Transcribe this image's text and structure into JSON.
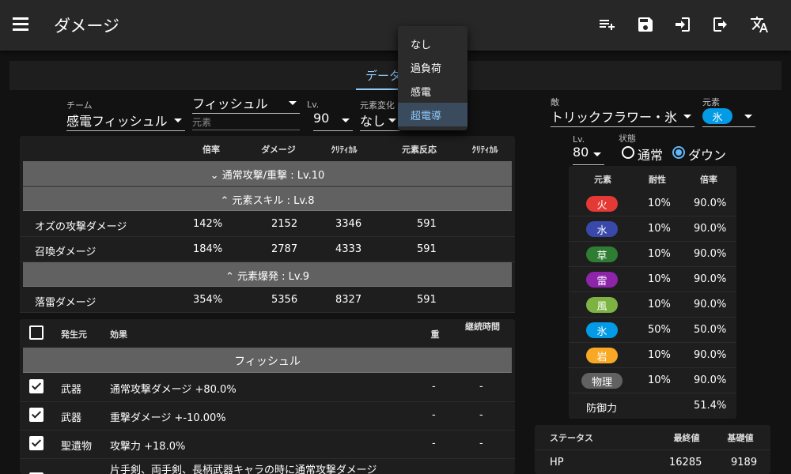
{
  "app": {
    "title": "ダメージ"
  },
  "tabs": {
    "active_label": "データ"
  },
  "team": {
    "caption": "チーム",
    "value": "感電フィッシュル",
    "character": "フィッシュル",
    "element_hint": "元素",
    "lv_caption": "Lv.",
    "lv_value": "90",
    "reaction_caption": "元素変化",
    "reaction_value": "なし"
  },
  "reaction_menu": {
    "items": [
      "なし",
      "過負荷",
      "感電",
      "超電導"
    ],
    "selected": "超電導"
  },
  "damage_table": {
    "headers": [
      "倍率",
      "ダメージ",
      "ｸﾘﾃｨｶﾙ",
      "元素反応",
      "ｸﾘﾃｨｶﾙ"
    ],
    "groups": [
      "通常攻撃/重撃 : Lv.10",
      "元素スキル : Lv.8",
      "元素爆発 : Lv.9"
    ],
    "rows": [
      {
        "name": "オズの攻撃ダメージ",
        "mult": "142%",
        "dmg": "2152",
        "crit": "3346",
        "react": "591"
      },
      {
        "name": "召喚ダメージ",
        "mult": "184%",
        "dmg": "2787",
        "crit": "4333",
        "react": "591"
      },
      {
        "name": "落雷ダメージ",
        "mult": "354%",
        "dmg": "5356",
        "crit": "8327",
        "react": "591"
      }
    ]
  },
  "buff_table": {
    "headers": {
      "source": "発生元",
      "effect": "効果",
      "stack": "重",
      "duration": "継続時間"
    },
    "group": "フィッシュル",
    "rows": [
      {
        "source": "武器",
        "effect": "通常攻撃ダメージ +80.0%",
        "stack": "-",
        "duration": "-"
      },
      {
        "source": "武器",
        "effect": "重撃ダメージ +-10.00%",
        "stack": "-",
        "duration": "-"
      },
      {
        "source": "聖遺物",
        "effect": "攻撃力 +18.0%",
        "stack": "-",
        "duration": "-"
      },
      {
        "source": "武器",
        "effect": "片手剣、両手剣、長柄武器キャラの時に通常攻撃ダメージ",
        "stack": "",
        "duration": ""
      }
    ]
  },
  "enemy": {
    "caption": "敵",
    "value": "トリックフラワー・氷",
    "element_caption": "元素",
    "element_value": "氷",
    "lv_caption": "Lv.",
    "lv_value": "80",
    "state_caption": "状態",
    "state_options": [
      "通常",
      "ダウン"
    ],
    "state_selected": "ダウン"
  },
  "resist_table": {
    "headers": [
      "元素",
      "耐性",
      "倍率"
    ],
    "rows": [
      {
        "el": "火",
        "res": "10%",
        "mult": "90.0%",
        "color": "#e53935"
      },
      {
        "el": "水",
        "res": "10%",
        "mult": "90.0%",
        "color": "#3949ab"
      },
      {
        "el": "草",
        "res": "10%",
        "mult": "90.0%",
        "color": "#2e7d32"
      },
      {
        "el": "雷",
        "res": "10%",
        "mult": "90.0%",
        "color": "#8e24aa"
      },
      {
        "el": "風",
        "res": "10%",
        "mult": "90.0%",
        "color": "#7cb342"
      },
      {
        "el": "氷",
        "res": "50%",
        "mult": "50.0%",
        "color": "#039be5"
      },
      {
        "el": "岩",
        "res": "10%",
        "mult": "90.0%",
        "color": "#f9a825"
      },
      {
        "el": "物理",
        "res": "10%",
        "mult": "90.0%",
        "color": "#616161"
      }
    ],
    "defense_label": "防御力",
    "defense_value": "51.4%"
  },
  "status_table": {
    "headers": [
      "ステータス",
      "最終値",
      "基礎値"
    ],
    "rows": [
      {
        "name": "HP",
        "final": "16285",
        "base": "9189"
      }
    ]
  }
}
